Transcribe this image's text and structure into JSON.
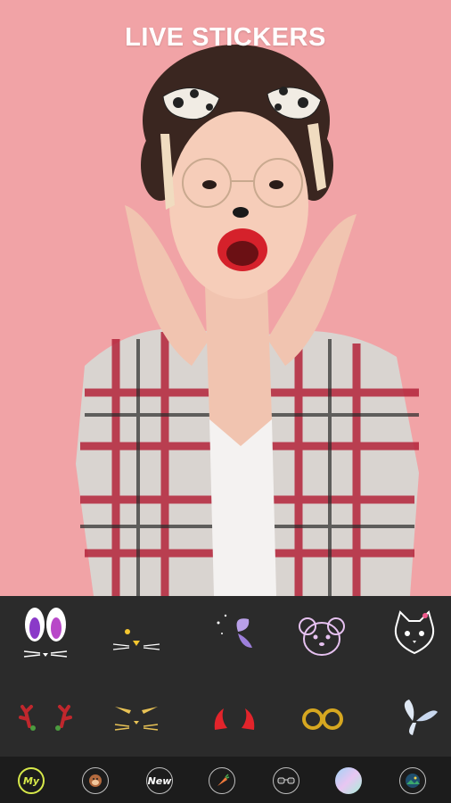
{
  "promo": {
    "title": "LIVE STICKERS"
  },
  "stickers_row1": [
    {
      "icon": "bunny-ears-whiskers-icon"
    },
    {
      "icon": "cat-nose-whiskers-icon"
    },
    {
      "icon": "butterfly-sparkle-icon"
    },
    {
      "icon": "mouse-face-icon"
    },
    {
      "icon": "kitty-face-icon"
    }
  ],
  "stickers_row2": [
    {
      "icon": "reindeer-antlers-icon"
    },
    {
      "icon": "cat-eyes-whiskers-icon"
    },
    {
      "icon": "devil-horns-icon"
    },
    {
      "icon": "gold-bow-icon"
    },
    {
      "icon": "angel-wings-icon"
    }
  ],
  "categories": [
    {
      "label": "My",
      "icon": "my-category-icon",
      "active": true
    },
    {
      "label": "",
      "icon": "monkey-category-icon"
    },
    {
      "label": "New",
      "icon": "new-category-icon"
    },
    {
      "label": "",
      "icon": "carrot-category-icon"
    },
    {
      "label": "",
      "icon": "glasses-category-icon"
    },
    {
      "label": "",
      "icon": "holographic-category-icon"
    },
    {
      "label": "",
      "icon": "landscape-category-icon"
    }
  ],
  "colors": {
    "photo_bg": "#f1a3a6",
    "panel_bg": "#2b2b2b",
    "bar_bg": "#1c1c1c",
    "active": "#d7e94a"
  }
}
